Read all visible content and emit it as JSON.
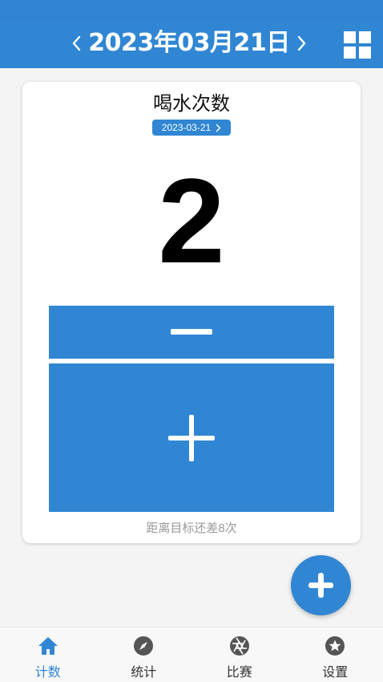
{
  "header": {
    "date": "2023年03月21日",
    "prev_icon": "chevron-left-icon",
    "next_icon": "chevron-right-icon",
    "menu_icon": "grid-icon"
  },
  "card": {
    "title": "喝水次数",
    "date_chip": "2023-03-21",
    "count": "2",
    "remaining": "距离目标还差8次"
  },
  "tabs": [
    {
      "label": "计数",
      "icon": "home-icon",
      "active": true
    },
    {
      "label": "统计",
      "icon": "compass-icon",
      "active": false
    },
    {
      "label": "比赛",
      "icon": "aperture-icon",
      "active": false
    },
    {
      "label": "设置",
      "icon": "star-icon",
      "active": false
    }
  ],
  "colors": {
    "primary": "#3086d3",
    "background": "#f4f4f4",
    "muted_text": "#9a9a9a"
  }
}
